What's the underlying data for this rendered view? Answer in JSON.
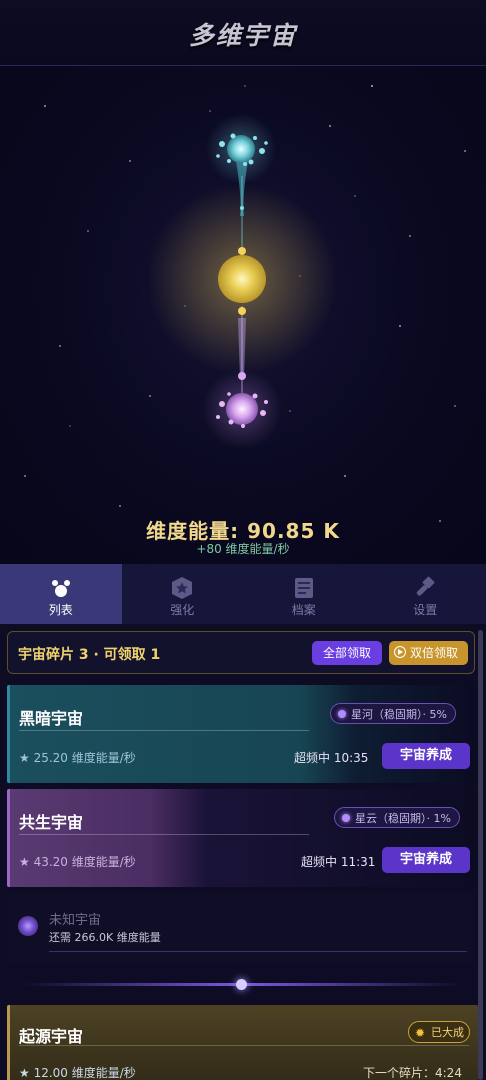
{
  "header": {
    "title": "多维宇宙"
  },
  "scene": {
    "energy_label": "维度能量: 90.85 K",
    "rate_label": "+80 维度能量/秒",
    "colors": {
      "top_orb": "#7fd6e0",
      "mid_orb": "#f3de6a",
      "bottom_orb": "#d8a8f0"
    }
  },
  "tabs": [
    {
      "label": "列表",
      "icon": "list-icon",
      "active": true
    },
    {
      "label": "强化",
      "icon": "upgrade-icon",
      "active": false
    },
    {
      "label": "档案",
      "icon": "archive-icon",
      "active": false
    },
    {
      "label": "设置",
      "icon": "settings-icon",
      "active": false
    }
  ],
  "shards": {
    "text": "宇宙碎片 3 · 可领取 1",
    "claim_all": "全部领取",
    "double_claim": "双倍领取"
  },
  "universes": [
    {
      "name": "黑暗宇宙",
      "badge": "星河（稳固期）· 5%",
      "stat": "★ 25.20 维度能量/秒",
      "timer": "超频中 10:35",
      "action": "宇宙养成"
    },
    {
      "name": "共生宇宙",
      "badge": "星云（稳固期）· 1%",
      "stat": "★ 43.20 维度能量/秒",
      "timer": "超频中 11:31",
      "action": "宇宙养成"
    }
  ],
  "unknown": {
    "name": "未知宇宙",
    "need": "还需 266.0K 维度能量"
  },
  "origin": {
    "name": "起源宇宙",
    "badge": "已大成",
    "stat": "★ 12.00 维度能量/秒",
    "next": "下一个碎片：4:24"
  }
}
